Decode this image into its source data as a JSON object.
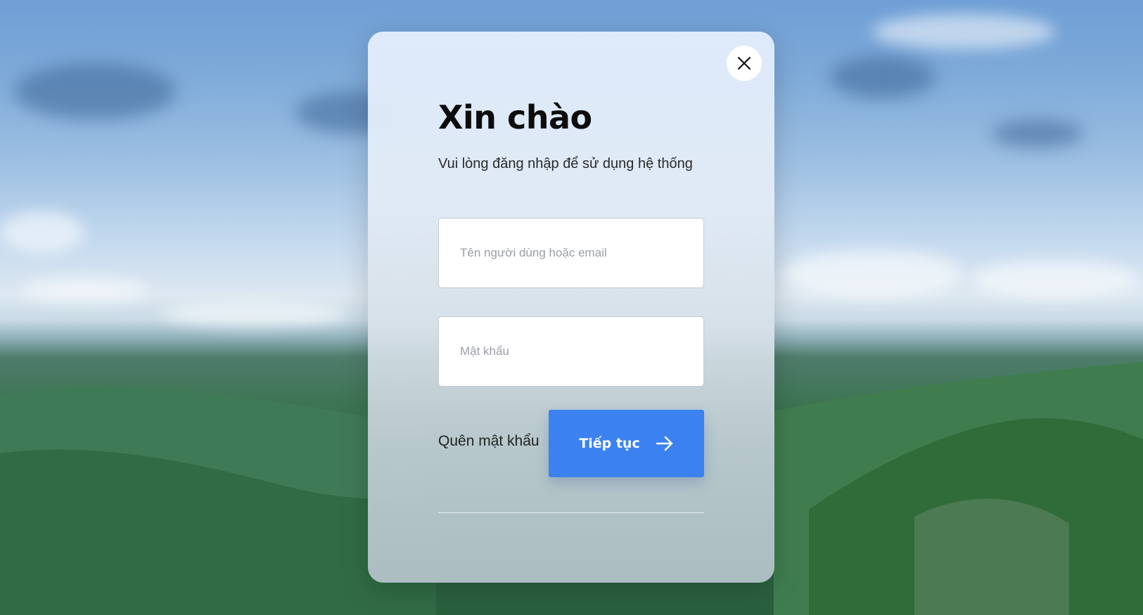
{
  "login": {
    "title": "Xin chào",
    "subtitle": "Vui lòng đăng nhập để sử dụng hệ thống",
    "username_placeholder": "Tên người dùng hoặc email",
    "password_placeholder": "Mật khẩu",
    "forgot_label": "Quên mật khẩu",
    "continue_label": "Tiếp tục"
  },
  "icons": {
    "close": "close-icon",
    "arrow": "arrow-right-icon"
  },
  "colors": {
    "accent": "#3b82f0",
    "title": "#0d0d0d"
  }
}
